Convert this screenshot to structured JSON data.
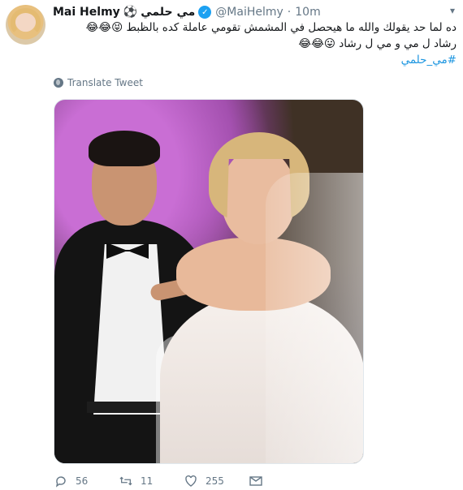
{
  "user": {
    "display_name": "Mai Helmy",
    "soccer_emoji": "⚽",
    "arabic_name": "مي حلمي",
    "handle": "@MaiHelmy",
    "separator": "·",
    "timestamp": "10m"
  },
  "tweet": {
    "lines": [
      "ده لما حد يقولك والله ما هيحصل في المشمش تقومي عاملة كده بالظبط 😝😂😂",
      "رشاد ل مي و مي ل رشاد 😛😂😂"
    ],
    "hashtag": "#مي_حلمي"
  },
  "translate": {
    "label": "Translate Tweet",
    "icon": "globe-icon"
  },
  "actions": {
    "reply_count": "56",
    "retweet_count": "11",
    "like_count": "255"
  },
  "colors": {
    "link": "#1b95e0",
    "verified": "#1da1f2",
    "muted": "#657786"
  }
}
